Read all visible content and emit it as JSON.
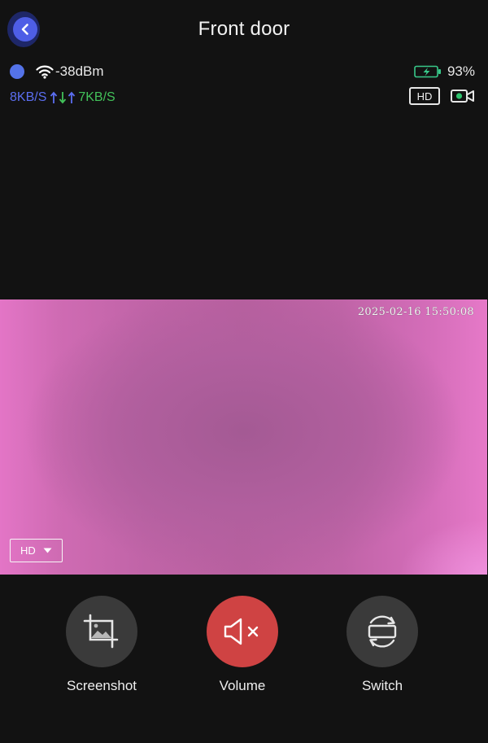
{
  "header": {
    "title": "Front door"
  },
  "status": {
    "signal": "-38dBm",
    "download_rate": "8KB/S",
    "upload_rate": "7KB/S",
    "battery": "93%",
    "quality_badge": "HD"
  },
  "video": {
    "timestamp": "2025-02-16 15:50:08",
    "quality_select": "HD"
  },
  "controls": [
    {
      "label": "Screenshot",
      "icon": "crop-image-icon"
    },
    {
      "label": "Volume",
      "icon": "volume-mute-icon"
    },
    {
      "label": "Switch",
      "icon": "switch-rotate-icon"
    }
  ],
  "colors": {
    "background": "#121212",
    "accent": "#5473e8",
    "download": "#5b6ef0",
    "upload": "#42c25a",
    "battery": "#38c98a",
    "mute_active": "#cf4343",
    "control_bg": "#3a3a3a"
  }
}
